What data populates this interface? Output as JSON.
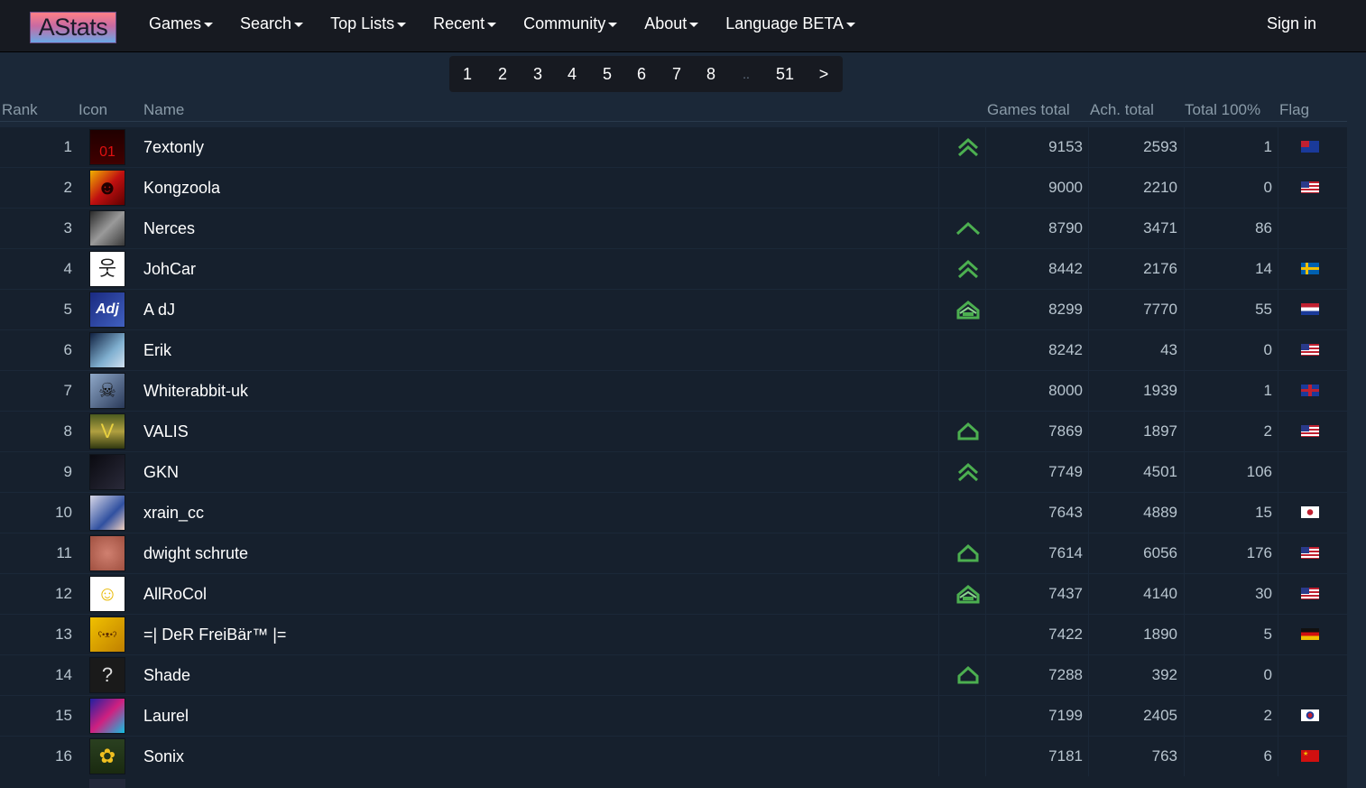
{
  "nav": {
    "logo": "AStats",
    "items": [
      "Games",
      "Search",
      "Top Lists",
      "Recent",
      "Community",
      "About",
      "Language BETA"
    ],
    "signin": "Sign in"
  },
  "pagination": [
    "1",
    "2",
    "3",
    "4",
    "5",
    "6",
    "7",
    "8",
    "..",
    "51",
    ">"
  ],
  "table": {
    "headers": {
      "rank": "Rank",
      "icon": "Icon",
      "name": "Name",
      "games_total": "Games total",
      "ach_total": "Ach. total",
      "total_100": "Total 100%",
      "flag": "Flag"
    },
    "rows": [
      {
        "rank": "1",
        "name": "7extonly",
        "level": "double-chevron",
        "games": "9153",
        "ach": "2593",
        "total100": "1",
        "flag": "au",
        "avatar": "red-binary"
      },
      {
        "rank": "2",
        "name": "Kongzoola",
        "level": "",
        "games": "9000",
        "ach": "2210",
        "total100": "0",
        "flag": "us",
        "avatar": "red-figure"
      },
      {
        "rank": "3",
        "name": "Nerces",
        "level": "single-chevron",
        "games": "8790",
        "ach": "3471",
        "total100": "86",
        "flag": "",
        "avatar": "grey-dragon"
      },
      {
        "rank": "4",
        "name": "JohCar",
        "level": "double-chevron",
        "games": "8442",
        "ach": "2176",
        "total100": "14",
        "flag": "se",
        "avatar": "stick-figure"
      },
      {
        "rank": "5",
        "name": "A dJ",
        "level": "house-ribbon",
        "games": "8299",
        "ach": "7770",
        "total100": "55",
        "flag": "nl",
        "avatar": "adj-logo"
      },
      {
        "rank": "6",
        "name": "Erik",
        "level": "",
        "games": "8242",
        "ach": "43",
        "total100": "0",
        "flag": "us",
        "avatar": "elsa"
      },
      {
        "rank": "7",
        "name": "Whiterabbit-uk",
        "level": "",
        "games": "8000",
        "ach": "1939",
        "total100": "1",
        "flag": "gb",
        "avatar": "cat-face"
      },
      {
        "rank": "8",
        "name": "VALIS",
        "level": "house",
        "games": "7869",
        "ach": "1897",
        "total100": "2",
        "flag": "us",
        "avatar": "valis"
      },
      {
        "rank": "9",
        "name": "GKN",
        "level": "double-chevron",
        "games": "7749",
        "ach": "4501",
        "total100": "106",
        "flag": "",
        "avatar": "dark"
      },
      {
        "rank": "10",
        "name": "xrain_cc",
        "level": "",
        "games": "7643",
        "ach": "4889",
        "total100": "15",
        "flag": "jp",
        "avatar": "anime-girl"
      },
      {
        "rank": "11",
        "name": "dwight schrute",
        "level": "house",
        "games": "7614",
        "ach": "6056",
        "total100": "176",
        "flag": "us",
        "avatar": "faces"
      },
      {
        "rank": "12",
        "name": "AllRoCol",
        "level": "house-ribbon",
        "games": "7437",
        "ach": "4140",
        "total100": "30",
        "flag": "us",
        "avatar": "homer"
      },
      {
        "rank": "13",
        "name": "=| DeR FreiBär™ |=",
        "level": "",
        "games": "7422",
        "ach": "1890",
        "total100": "5",
        "flag": "de",
        "avatar": "bear"
      },
      {
        "rank": "14",
        "name": "Shade",
        "level": "house",
        "games": "7288",
        "ach": "392",
        "total100": "0",
        "flag": "",
        "avatar": "question"
      },
      {
        "rank": "15",
        "name": "Laurel",
        "level": "",
        "games": "7199",
        "ach": "2405",
        "total100": "2",
        "flag": "kr",
        "avatar": "colorful"
      },
      {
        "rank": "16",
        "name": "Sonix",
        "level": "",
        "games": "7181",
        "ach": "763",
        "total100": "6",
        "flag": "cn",
        "avatar": "sunflower"
      }
    ]
  },
  "colors": {
    "background": "#1b2838",
    "navbar": "#171a21",
    "row": "#16202d",
    "level_icon": "#4caf50"
  }
}
